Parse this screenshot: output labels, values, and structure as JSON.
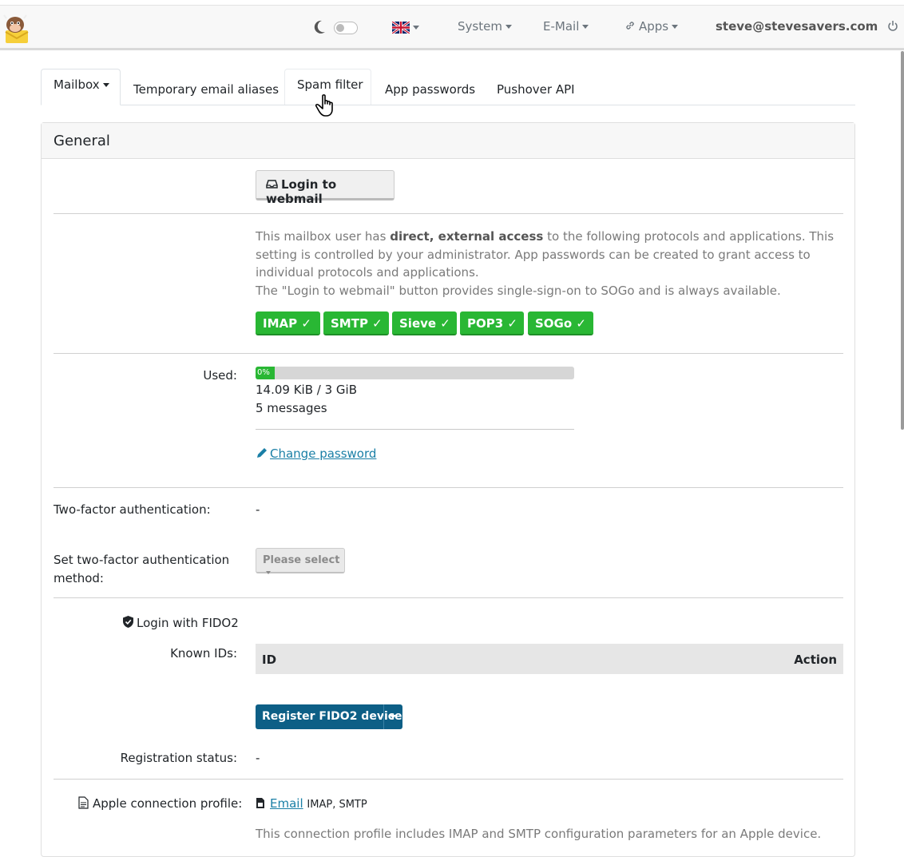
{
  "navbar": {
    "language_flag": "uk-flag-icon",
    "system_label": "System",
    "email_label": "E-Mail",
    "apps_label": "Apps",
    "user_email": "steve@stevesavers.com"
  },
  "tabs": [
    {
      "label": "Mailbox"
    },
    {
      "label": "Temporary email aliases"
    },
    {
      "label": "Spam filter"
    },
    {
      "label": "App passwords"
    },
    {
      "label": "Pushover API"
    }
  ],
  "panel": {
    "title": "General",
    "webmail_button": "Login to webmail",
    "access_text_1": "This mailbox user has ",
    "access_text_bold": "direct, external access",
    "access_text_2": " to the following protocols and applications. This setting is controlled by your administrator. App passwords can be created to grant access to individual protocols and applications.",
    "access_text_3": "The \"Login to webmail\" button provides single-sign-on to SOGo and is always available.",
    "protocols": [
      "IMAP ✓",
      "SMTP ✓",
      "Sieve ✓",
      "POP3 ✓",
      "SOGo ✓"
    ],
    "used_label": "Used:",
    "used_percent_label": "0%",
    "used_fraction": 0.0,
    "used_size": "14.09 KiB / 3 GiB",
    "used_messages": "5 messages",
    "change_password": "Change password",
    "tfa_label": "Two-factor authentication:",
    "tfa_value": "-",
    "tfa_method_label": "Set two-factor authentication method:",
    "tfa_method_select": "Please select",
    "fido_label": "Login with FIDO2",
    "known_ids_label": "Known IDs:",
    "table_id": "ID",
    "table_action": "Action",
    "register_button": "Register FIDO2 device",
    "reg_status_label": "Registration status:",
    "reg_status_value": "-",
    "apple_label": "Apple connection profile:",
    "apple_link": "Email",
    "apple_protocols": "IMAP, SMTP",
    "apple_note": "This connection profile includes IMAP and SMTP configuration parameters for an Apple device."
  },
  "colors": {
    "success": "#29b734",
    "primary_button": "#0d5f86",
    "link": "#1a7fa6"
  }
}
